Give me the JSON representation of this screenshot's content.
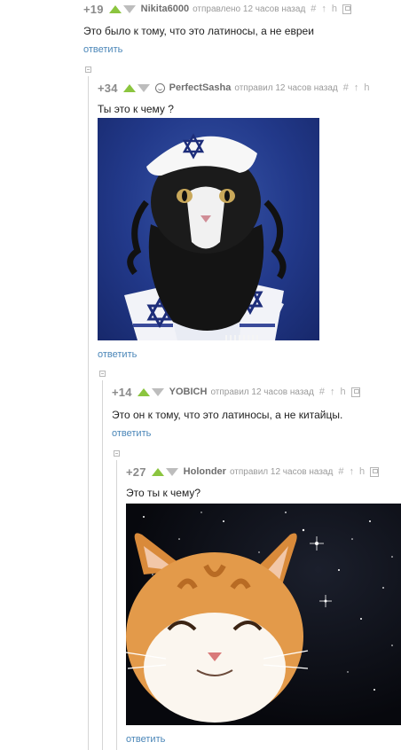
{
  "comments": [
    {
      "rating": "+19",
      "author": "Nikita6000",
      "action": "отправлено 12 часов назад",
      "text": "Это было к тому, что это латиносы, а не евреи",
      "reply": "ответить",
      "tools": [
        "#",
        "↑",
        "h"
      ]
    },
    {
      "rating": "+34",
      "author": "PerfectSasha",
      "action": "отправил 12 часов назад",
      "text": "Ты это к чему ?",
      "reply": "ответить",
      "tools": [
        "#",
        "↑",
        "h"
      ]
    },
    {
      "rating": "+14",
      "author": "YOBICH",
      "action": "отправил 12 часов назад",
      "text": "Это он к тому, что это латиносы, а не китайцы.",
      "reply": "ответить",
      "tools": [
        "#",
        "↑",
        "h"
      ]
    },
    {
      "rating": "+27",
      "author": "Holonder",
      "action": "отправил 12 часов назад",
      "text": "Это ты к чему?",
      "reply": "ответить",
      "tools": [
        "#",
        "↑",
        "h"
      ]
    }
  ],
  "colors": {
    "upvote": "#8bc53f",
    "downvote": "#bdbdbd",
    "link": "#4a86b8",
    "rating": "#8a8a8a"
  },
  "icons": [
    "upvote-arrow-icon",
    "downvote-arrow-icon",
    "hash-link-icon",
    "parent-arrow-icon",
    "branch-icon",
    "save-icon",
    "collapse-icon",
    "avatar-smile-icon"
  ]
}
